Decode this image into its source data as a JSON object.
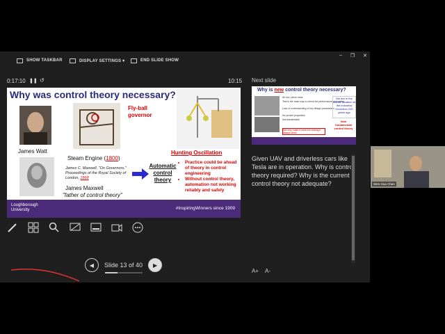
{
  "toolbar": {
    "show_taskbar": "SHOW TASKBAR",
    "display_settings": "DISPLAY SETTINGS ▾",
    "end_slide_show": "END SLIDE SHOW"
  },
  "window_controls": {
    "minimize": "–",
    "restore": "❐",
    "close": "✕"
  },
  "presenter": {
    "timer": "0:17:10",
    "pause": "❚❚",
    "reset": "↺",
    "clock": "10:15",
    "next_slide_label": "Next slide"
  },
  "slide": {
    "title": "Why was control theory necessary?",
    "james_watt": "James Watt",
    "steam_engine_prefix": "Steam Engine (",
    "steam_engine_year": "1800",
    "steam_engine_suffix": ")",
    "flyball": "Fly-ball governor",
    "hunting": "Hunting Oscillation",
    "maxwell_ref_1": "James C. Maxwell, \"On Governors,\"",
    "maxwell_ref_2": "Proceedings of the Royal Society of",
    "maxwell_ref_3": "London,",
    "maxwell_year": "1868",
    "james_maxwell": "James Maxwell",
    "father": "\"father of control theory\"",
    "automatic": "Automatic control theory",
    "bullet_1": "Practice could be ahead of theory in control engineering",
    "bullet_2": "Without control theory, automation not working reliably and safely",
    "logo_1": "Loughborough",
    "logo_2": "University",
    "hashtag": "#InspiringWinners since 1909"
  },
  "next_slide": {
    "title_prefix": "Why is ",
    "title_new": "new",
    "title_suffix": " control theory necessary?",
    "bullets": [
      "All hoc, piece meal",
      "Test is the main way to check the performance and safety",
      "Lack of understanding of key design parameters",
      "No proven properties",
      "Not transferable"
    ],
    "box_text": "We are in the similar situation at the industrial revolution 200 years ago",
    "new_theory": "New fundamental control theory",
    "footnote": "Not only make it work but making it always work!"
  },
  "notes": {
    "text": "Given UAV and driverless cars like Tesla are in operation. Why is control theory required? Why is the current control theory not adequate?"
  },
  "font_controls": {
    "increase": "A+",
    "decrease": "A-"
  },
  "navigation": {
    "slide_counter": "Slide 13 of 40",
    "progress": 0.33
  },
  "camera": {
    "name": "Wen-Hua Chen"
  },
  "colors": {
    "accent_purple": "#4b2a7a",
    "title_blue": "#2a2a7a",
    "alert_red": "#dd0000"
  }
}
